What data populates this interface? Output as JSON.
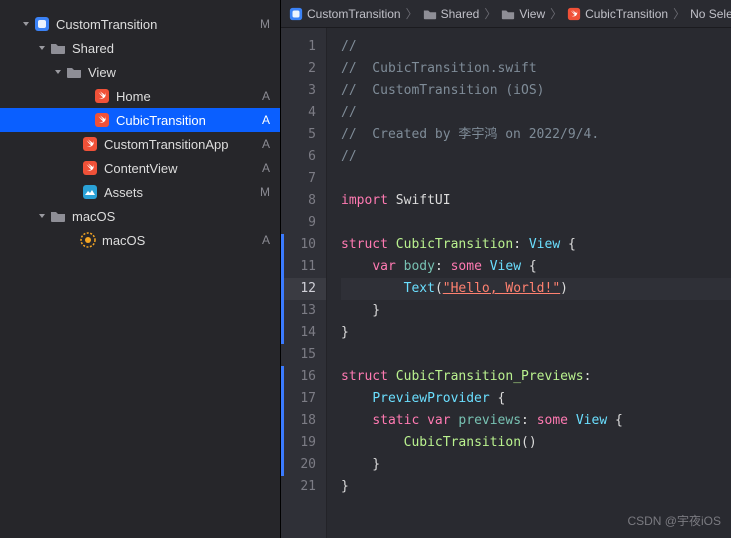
{
  "sidebar": {
    "items": [
      {
        "label": "CustomTransition",
        "badge": "M",
        "indent": 20,
        "icon": "app",
        "disclosure": "down",
        "selected": false
      },
      {
        "label": "Shared",
        "badge": "",
        "indent": 36,
        "icon": "folder",
        "disclosure": "down",
        "selected": false
      },
      {
        "label": "View",
        "badge": "",
        "indent": 52,
        "icon": "folder",
        "disclosure": "down",
        "selected": false
      },
      {
        "label": "Home",
        "badge": "A",
        "indent": 80,
        "icon": "swift",
        "disclosure": "",
        "selected": false
      },
      {
        "label": "CubicTransition",
        "badge": "A",
        "indent": 80,
        "icon": "swift",
        "disclosure": "",
        "selected": true
      },
      {
        "label": "CustomTransitionApp",
        "badge": "A",
        "indent": 68,
        "icon": "swift",
        "disclosure": "",
        "selected": false
      },
      {
        "label": "ContentView",
        "badge": "A",
        "indent": 68,
        "icon": "swift",
        "disclosure": "",
        "selected": false
      },
      {
        "label": "Assets",
        "badge": "M",
        "indent": 68,
        "icon": "assets",
        "disclosure": "",
        "selected": false
      },
      {
        "label": "macOS",
        "badge": "",
        "indent": 36,
        "icon": "folder",
        "disclosure": "down",
        "selected": false
      },
      {
        "label": "macOS",
        "badge": "A",
        "indent": 66,
        "icon": "entitle",
        "disclosure": "",
        "selected": false
      }
    ]
  },
  "breadcrumb": {
    "items": [
      {
        "icon": "app",
        "label": "CustomTransition"
      },
      {
        "icon": "folder",
        "label": "Shared"
      },
      {
        "icon": "folder",
        "label": "View"
      },
      {
        "icon": "swift",
        "label": "CubicTransition"
      },
      {
        "icon": "",
        "label": "No Select..."
      }
    ]
  },
  "code": {
    "lines": [
      {
        "n": 1,
        "tokens": [
          {
            "c": "comment",
            "t": "//"
          }
        ]
      },
      {
        "n": 2,
        "tokens": [
          {
            "c": "comment",
            "t": "//  CubicTransition.swift"
          }
        ]
      },
      {
        "n": 3,
        "tokens": [
          {
            "c": "comment",
            "t": "//  CustomTransition (iOS)"
          }
        ]
      },
      {
        "n": 4,
        "tokens": [
          {
            "c": "comment",
            "t": "//"
          }
        ]
      },
      {
        "n": 5,
        "tokens": [
          {
            "c": "comment",
            "t": "//  Created by 李宇鸿 on 2022/9/4."
          }
        ]
      },
      {
        "n": 6,
        "tokens": [
          {
            "c": "comment",
            "t": "//"
          }
        ]
      },
      {
        "n": 7,
        "tokens": []
      },
      {
        "n": 8,
        "tokens": [
          {
            "c": "keyword",
            "t": "import"
          },
          {
            "c": "plain",
            "t": " SwiftUI"
          }
        ]
      },
      {
        "n": 9,
        "tokens": []
      },
      {
        "n": 10,
        "rib": true,
        "tokens": [
          {
            "c": "keyword",
            "t": "struct"
          },
          {
            "c": "plain",
            "t": " "
          },
          {
            "c": "type",
            "t": "CubicTransition"
          },
          {
            "c": "plain",
            "t": ": "
          },
          {
            "c": "type2",
            "t": "View"
          },
          {
            "c": "plain",
            "t": " {"
          }
        ]
      },
      {
        "n": 11,
        "rib": true,
        "tokens": [
          {
            "c": "plain",
            "t": "    "
          },
          {
            "c": "keyword",
            "t": "var"
          },
          {
            "c": "plain",
            "t": " "
          },
          {
            "c": "attr",
            "t": "body"
          },
          {
            "c": "plain",
            "t": ": "
          },
          {
            "c": "keyword",
            "t": "some"
          },
          {
            "c": "plain",
            "t": " "
          },
          {
            "c": "type2",
            "t": "View"
          },
          {
            "c": "plain",
            "t": " {"
          }
        ]
      },
      {
        "n": 12,
        "hl": true,
        "rib": true,
        "tokens": [
          {
            "c": "plain",
            "t": "        "
          },
          {
            "c": "type2",
            "t": "Text"
          },
          {
            "c": "plain",
            "t": "("
          },
          {
            "c": "string",
            "t": "\"Hello, World!\"",
            "u": true
          },
          {
            "c": "plain",
            "t": ")"
          }
        ]
      },
      {
        "n": 13,
        "rib": true,
        "tokens": [
          {
            "c": "plain",
            "t": "    }"
          }
        ]
      },
      {
        "n": 14,
        "rib": true,
        "tokens": [
          {
            "c": "plain",
            "t": "}"
          }
        ]
      },
      {
        "n": 15,
        "tokens": []
      },
      {
        "n": 16,
        "rib": true,
        "tokens": [
          {
            "c": "keyword",
            "t": "struct"
          },
          {
            "c": "plain",
            "t": " "
          },
          {
            "c": "type",
            "t": "CubicTransition_Previews"
          },
          {
            "c": "plain",
            "t": ":"
          }
        ]
      },
      {
        "n": "",
        "rib": true,
        "cont": true,
        "tokens": [
          {
            "c": "plain",
            "t": "    "
          },
          {
            "c": "type2",
            "t": "PreviewProvider"
          },
          {
            "c": "plain",
            "t": " {"
          }
        ]
      },
      {
        "n": 17,
        "rib": true,
        "tokens": [
          {
            "c": "plain",
            "t": "    "
          },
          {
            "c": "keyword",
            "t": "static"
          },
          {
            "c": "plain",
            "t": " "
          },
          {
            "c": "keyword",
            "t": "var"
          },
          {
            "c": "plain",
            "t": " "
          },
          {
            "c": "attr",
            "t": "previews"
          },
          {
            "c": "plain",
            "t": ": "
          },
          {
            "c": "keyword",
            "t": "some"
          },
          {
            "c": "plain",
            "t": " "
          },
          {
            "c": "type2",
            "t": "View"
          },
          {
            "c": "plain",
            "t": " {"
          }
        ]
      },
      {
        "n": 18,
        "rib": true,
        "tokens": [
          {
            "c": "plain",
            "t": "        "
          },
          {
            "c": "type",
            "t": "CubicTransition"
          },
          {
            "c": "plain",
            "t": "()"
          }
        ]
      },
      {
        "n": 19,
        "rib": true,
        "tokens": [
          {
            "c": "plain",
            "t": "    }"
          }
        ]
      },
      {
        "n": 20,
        "rib": true,
        "tokens": [
          {
            "c": "plain",
            "t": "}"
          }
        ]
      },
      {
        "n": 21,
        "tokens": []
      }
    ]
  },
  "watermark": "CSDN @宇夜iOS"
}
